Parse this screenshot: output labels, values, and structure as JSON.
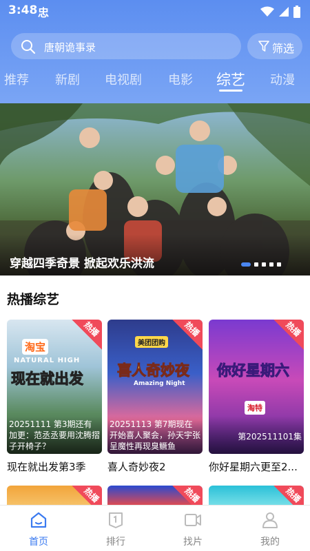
{
  "status_bar": {
    "time": "3:48",
    "app_glyph": "忠"
  },
  "search": {
    "placeholder": "唐朝诡事录"
  },
  "filter": {
    "label": "筛选"
  },
  "tabs": [
    {
      "label": "推荐"
    },
    {
      "label": "新剧"
    },
    {
      "label": "电视剧"
    },
    {
      "label": "电影"
    },
    {
      "label": "综艺",
      "active": true
    },
    {
      "label": "动漫"
    }
  ],
  "banner": {
    "caption": "穿越四季奇景 掀起欢乐洪流",
    "page_count": 5,
    "active_index": 0
  },
  "section": {
    "title": "热播综艺"
  },
  "cards": [
    {
      "badge": "热播",
      "logo_brand": "淘宝",
      "logo_sub": "NATURAL HIGH",
      "logo_title": "现在就出发",
      "description": "20251111 第3期还有加更：范丞丞要用沈腾摺子开椅子？",
      "title": "现在就出发第3季"
    },
    {
      "badge": "热播",
      "logo_brand": "美团团购",
      "logo_title": "喜人奇妙夜",
      "logo_sub": "Amazing Night",
      "description": "20251113 第7期现在开始喜人聚会，孙天宇张呈魔性再现臭鳜鱼",
      "title": "喜人奇妙夜2"
    },
    {
      "badge": "热播",
      "logo_title": "你好星期六",
      "logo_brand": "淘特",
      "description": "第202511101集",
      "title": "你好星期六更至2..."
    }
  ],
  "peek_cards": [
    {
      "badge": "热播"
    },
    {
      "badge": "热播"
    },
    {
      "badge": "热播"
    }
  ],
  "bottom_nav": [
    {
      "label": "首页",
      "icon": "home-icon",
      "active": true
    },
    {
      "label": "排行",
      "icon": "ranking-icon"
    },
    {
      "label": "找片",
      "icon": "video-search-icon"
    },
    {
      "label": "我的",
      "icon": "profile-icon"
    }
  ],
  "colors": {
    "accent": "#3a7af0",
    "header": "#5c8ef0",
    "hot_badge": "#f04a5a"
  }
}
